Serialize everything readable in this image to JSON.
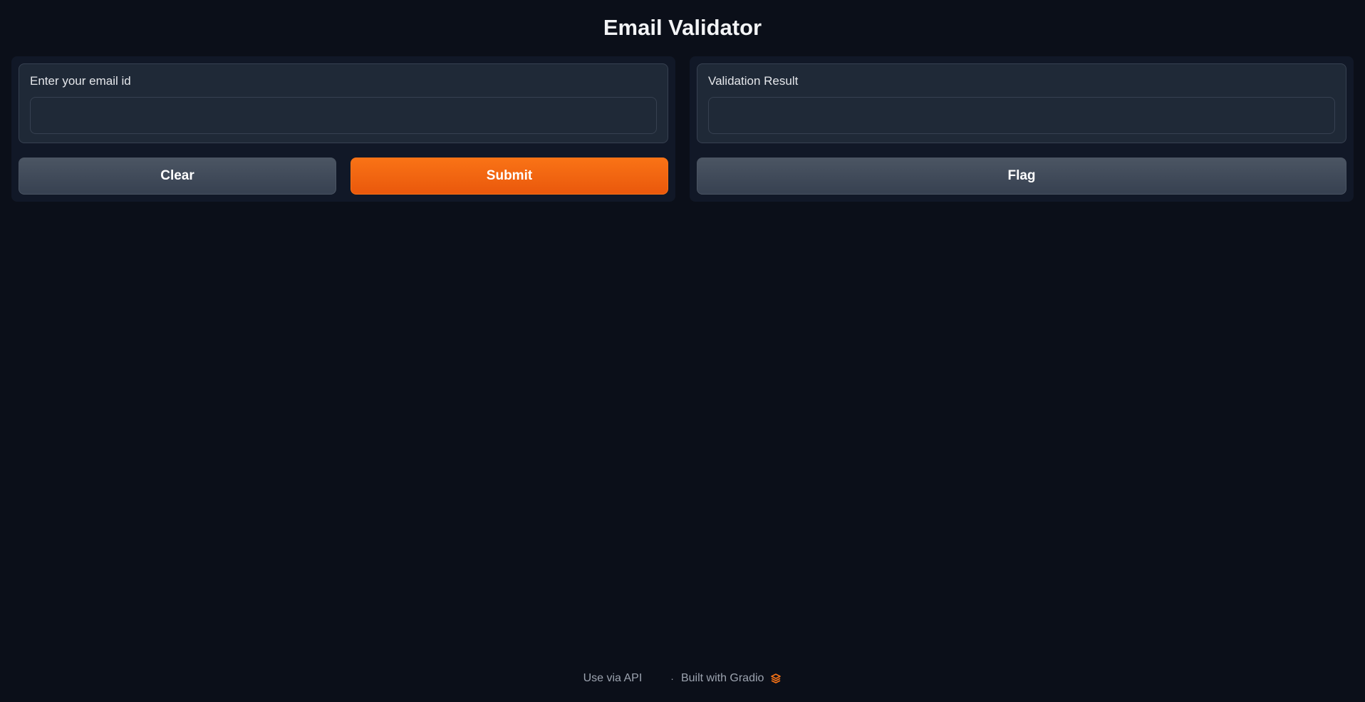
{
  "page": {
    "title": "Email Validator"
  },
  "input_panel": {
    "label": "Enter your email id",
    "value": "",
    "placeholder": "",
    "clear_label": "Clear",
    "submit_label": "Submit"
  },
  "output_panel": {
    "label": "Validation Result",
    "value": "",
    "flag_label": "Flag"
  },
  "footer": {
    "api_link": "Use via API",
    "separator": "·",
    "built_with": "Built with Gradio",
    "logo_icon": "gradio-logo-icon"
  },
  "colors": {
    "background": "#0b0f19",
    "panel": "#111827",
    "block": "#1f2937",
    "primary": "#f97316",
    "secondary": "#4b5563"
  }
}
